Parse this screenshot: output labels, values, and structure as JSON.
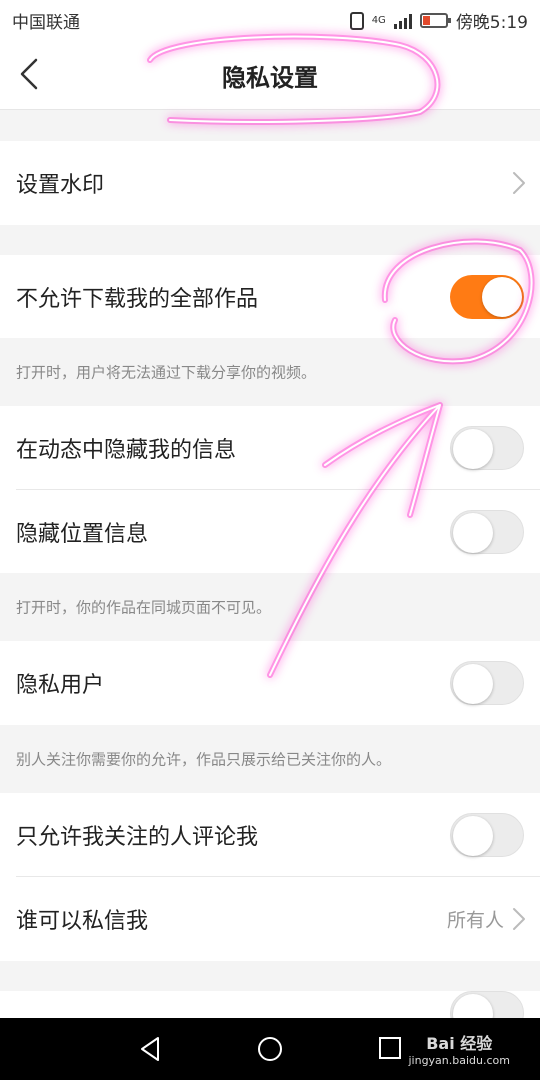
{
  "status_bar": {
    "carrier": "中国联通",
    "network": "4G",
    "time": "傍晚5:19"
  },
  "header": {
    "title": "隐私设置"
  },
  "settings": {
    "watermark_label": "设置水印",
    "no_download_label": "不允许下载我的全部作品",
    "no_download_on": true,
    "no_download_hint": "打开时，用户将无法通过下载分享你的视频。",
    "hide_in_feed_label": "在动态中隐藏我的信息",
    "hide_in_feed_on": false,
    "hide_location_label": "隐藏位置信息",
    "hide_location_on": false,
    "hide_location_hint": "打开时，你的作品在同城页面不可见。",
    "private_user_label": "隐私用户",
    "private_user_on": false,
    "private_user_hint": "别人关注你需要你的允许，作品只展示给已关注你的人。",
    "comment_followed_only_label": "只允许我关注的人评论我",
    "comment_followed_only_on": false,
    "who_can_dm_label": "谁可以私信我",
    "who_can_dm_value": "所有人"
  },
  "watermark_site": {
    "brand": "Bai 经验",
    "url": "jingyan.baidu.com"
  },
  "colors": {
    "accent": "#ff7b14",
    "annotation": "#ff3fd0"
  },
  "icons": {
    "back": "chevron-left-icon",
    "row_chevron": "chevron-right-icon",
    "nav_back": "triangle-back-icon",
    "nav_home": "circle-home-icon",
    "nav_recent": "square-recent-icon"
  }
}
